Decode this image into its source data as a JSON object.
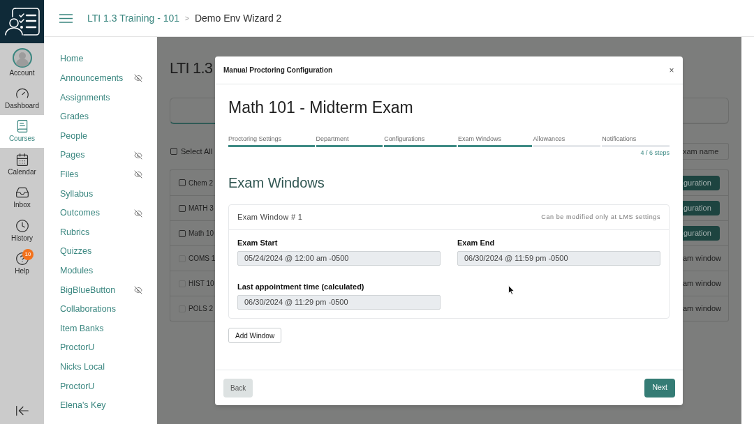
{
  "global_nav": {
    "items": [
      {
        "label": "Account",
        "kind": "account",
        "selected": false
      },
      {
        "label": "Dashboard",
        "kind": "dashboard",
        "selected": false
      },
      {
        "label": "Courses",
        "kind": "courses",
        "selected": true
      },
      {
        "label": "Calendar",
        "kind": "calendar",
        "selected": false
      },
      {
        "label": "Inbox",
        "kind": "inbox",
        "selected": false
      },
      {
        "label": "History",
        "kind": "history",
        "selected": false
      },
      {
        "label": "Help",
        "kind": "help",
        "selected": false,
        "badge": "10"
      }
    ]
  },
  "breadcrumb": {
    "course": "LTI 1.3 Training - 101",
    "separator": ">",
    "page": "Demo Env Wizard 2"
  },
  "course_nav": {
    "items": [
      {
        "label": "Home",
        "hidden": false
      },
      {
        "label": "Announcements",
        "hidden": true
      },
      {
        "label": "Assignments",
        "hidden": false
      },
      {
        "label": "Grades",
        "hidden": false
      },
      {
        "label": "People",
        "hidden": false
      },
      {
        "label": "Pages",
        "hidden": true
      },
      {
        "label": "Files",
        "hidden": true
      },
      {
        "label": "Syllabus",
        "hidden": false
      },
      {
        "label": "Outcomes",
        "hidden": true
      },
      {
        "label": "Rubrics",
        "hidden": false
      },
      {
        "label": "Quizzes",
        "hidden": false
      },
      {
        "label": "Modules",
        "hidden": false
      },
      {
        "label": "BigBlueButton",
        "hidden": true
      },
      {
        "label": "Collaborations",
        "hidden": false
      },
      {
        "label": "Item Banks",
        "hidden": false
      },
      {
        "label": "ProctorU",
        "hidden": false
      },
      {
        "label": "Nicks Local",
        "hidden": false
      },
      {
        "label": "ProctorU",
        "hidden": false
      },
      {
        "label": "Elena's Key",
        "hidden": false
      }
    ]
  },
  "background_page": {
    "heading": "LTI 1.3",
    "select_all": {
      "label": "Select All",
      "checked": false
    },
    "search": {
      "placeholder": "xam name"
    },
    "rows": [
      {
        "name": "Chem 2",
        "checked": false,
        "disabled": false,
        "action": "guration",
        "kind": "button"
      },
      {
        "name": "MATH 3",
        "checked": false,
        "disabled": false,
        "action": "guration",
        "kind": "button"
      },
      {
        "name": "Math 10",
        "checked": false,
        "disabled": false,
        "action": "guration",
        "kind": "button"
      },
      {
        "name": "COMS 1",
        "checked": false,
        "disabled": true,
        "action": "am window",
        "kind": "text"
      },
      {
        "name": "HIST 10",
        "checked": false,
        "disabled": true,
        "action": "am window",
        "kind": "text"
      },
      {
        "name": "POLS 2",
        "checked": false,
        "disabled": true,
        "action": "am window",
        "kind": "text"
      }
    ]
  },
  "modal": {
    "title": "Manual Proctoring Configuration",
    "close": "×",
    "exam_title": "Math 101 - Midterm Exam",
    "steps": [
      {
        "label": "Proctoring Settings",
        "completed": true
      },
      {
        "label": "Department",
        "completed": true
      },
      {
        "label": "Configurations",
        "completed": true
      },
      {
        "label": "Exam Windows",
        "completed": true
      },
      {
        "label": "Allowances",
        "completed": false
      },
      {
        "label": "Notifications",
        "completed": false
      }
    ],
    "progress": "4 / 6 steps",
    "section_title": "Exam Windows",
    "windows": [
      {
        "title": "Exam Window # 1",
        "note": "Can be modified only at LMS settings",
        "fields": [
          {
            "label": "Exam Start",
            "value": "05/24/2024 @ 12:00 am -0500"
          },
          {
            "label": "Exam End",
            "value": "06/30/2024 @ 11:59 pm -0500"
          },
          {
            "label": "Last appointment time (calculated)",
            "value": "06/30/2024 @ 11:29 pm -0500"
          }
        ]
      }
    ],
    "add_button": "Add Window",
    "back_button": "Back",
    "next_button": "Next"
  }
}
